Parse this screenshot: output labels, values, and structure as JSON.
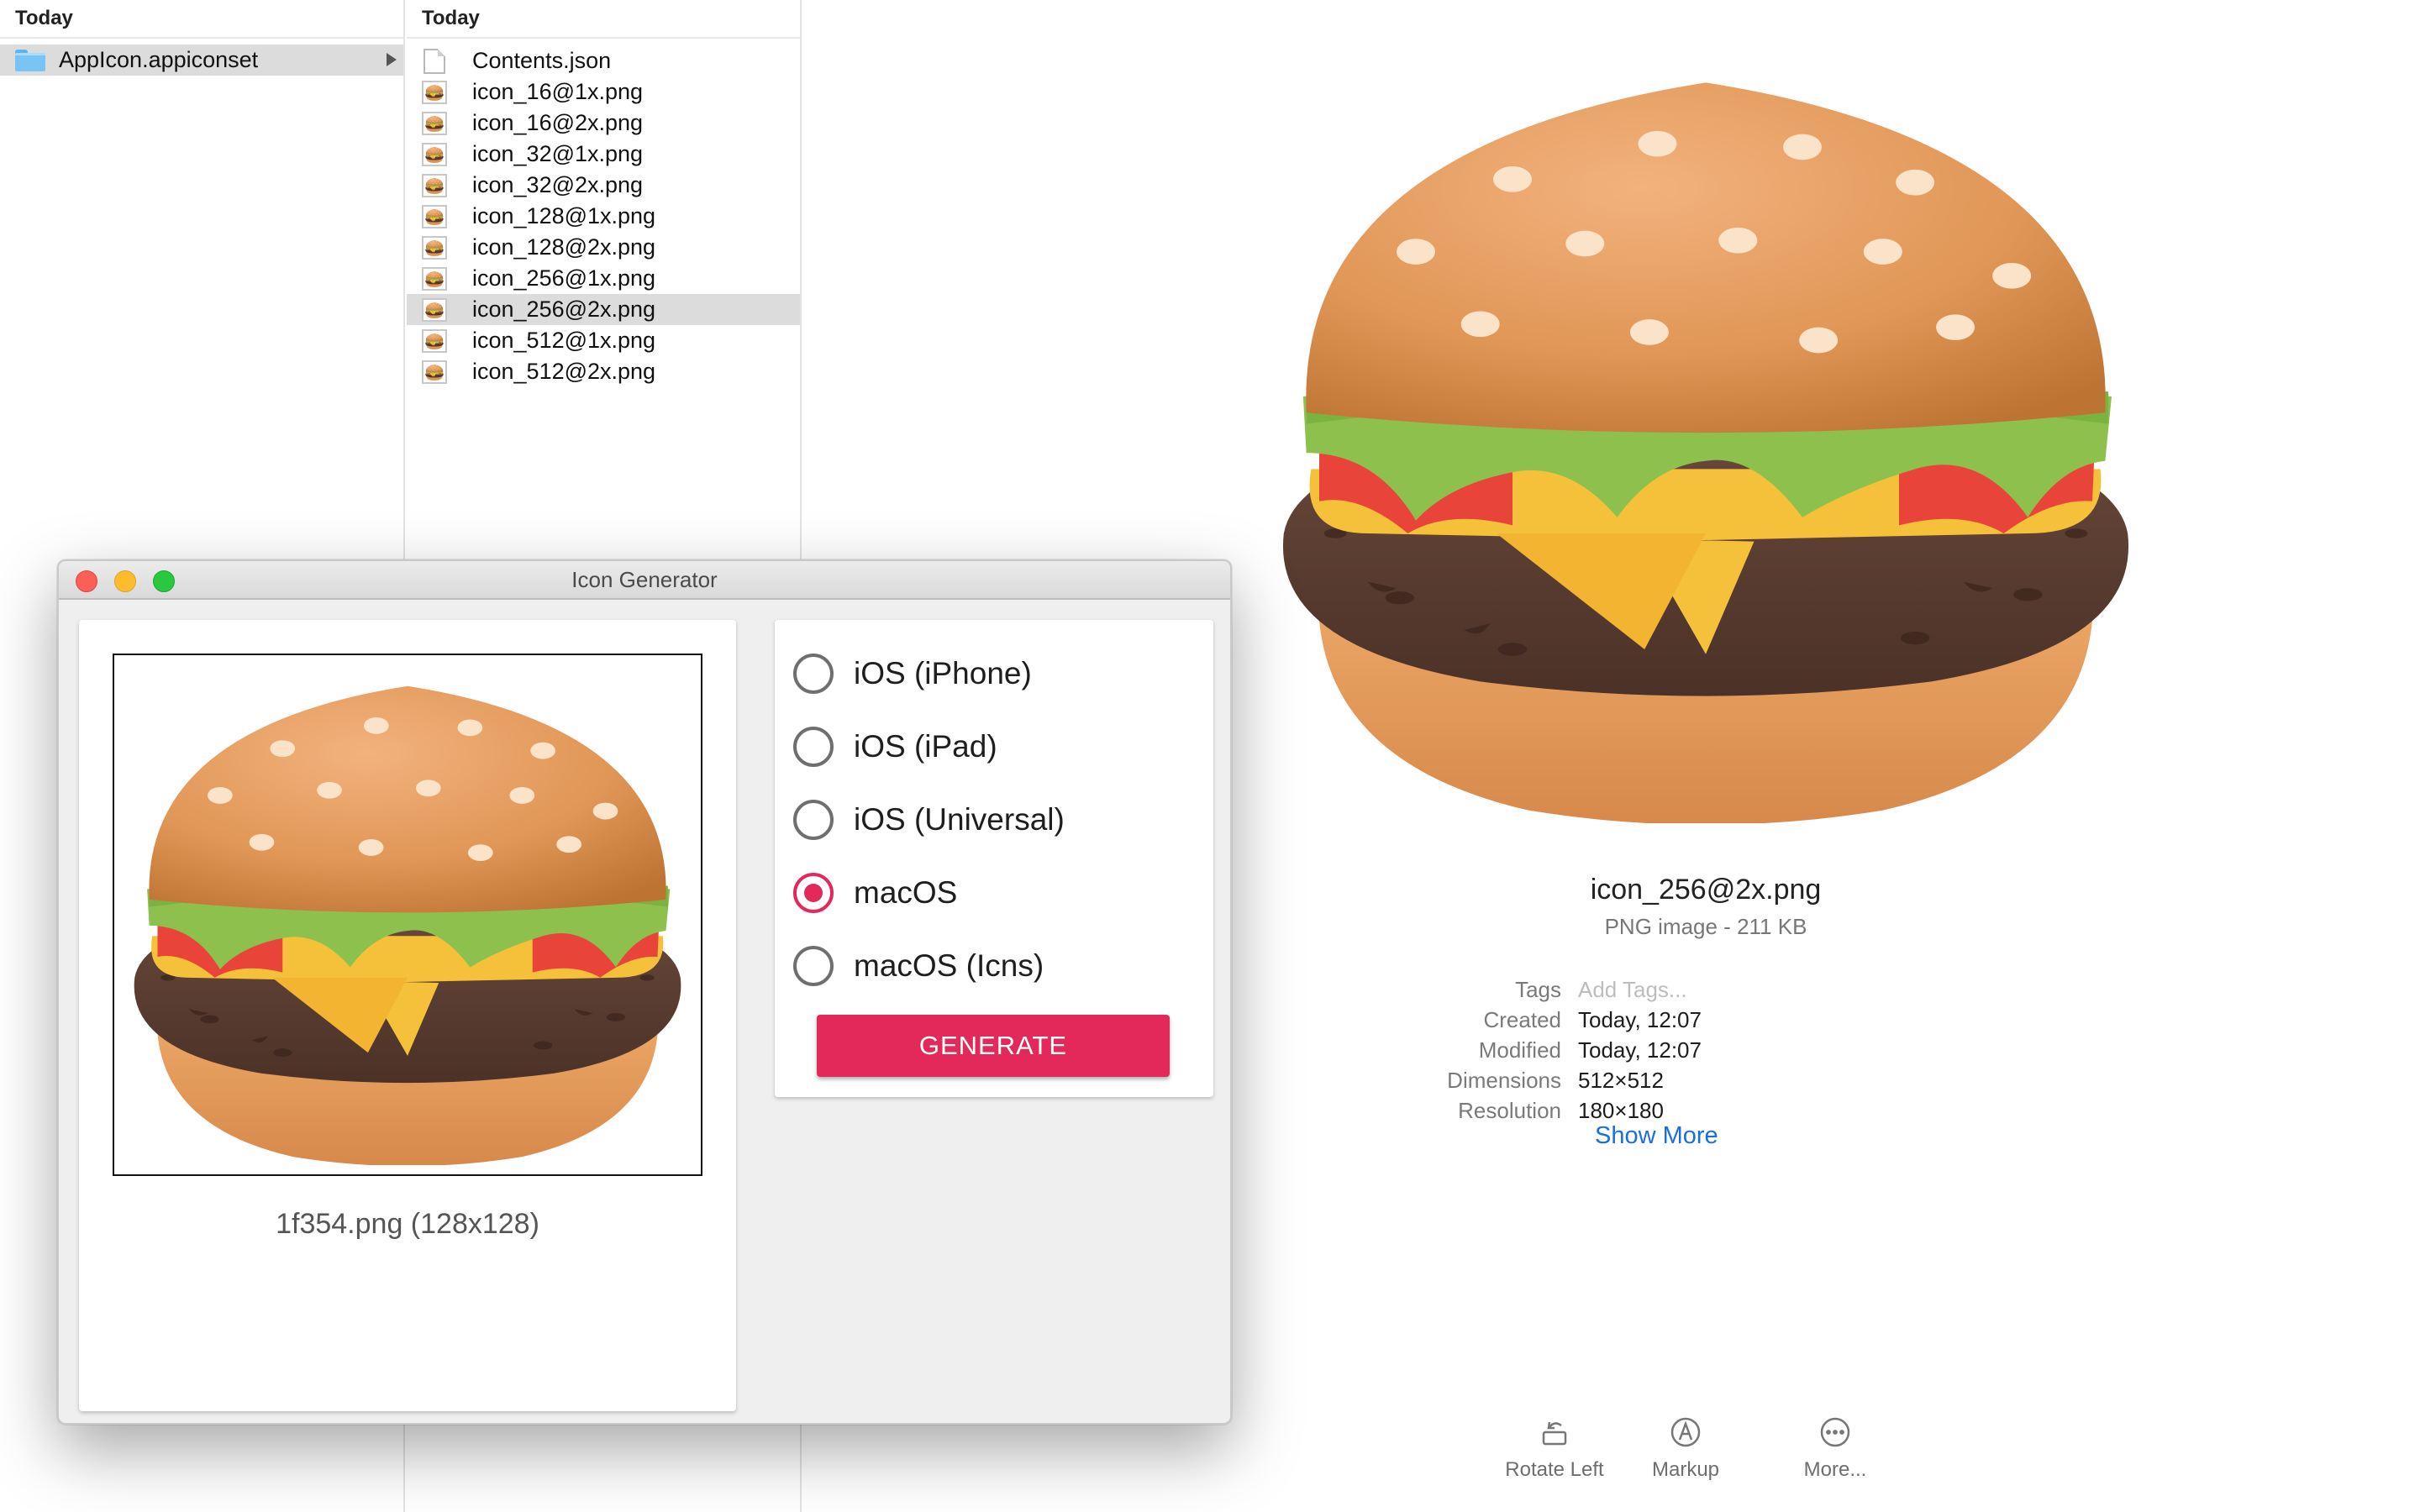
{
  "finder": {
    "column1": {
      "header": "Today",
      "items": [
        {
          "label": "AppIcon.appiconset",
          "type": "folder",
          "selected": true
        }
      ]
    },
    "column2": {
      "header": "Today",
      "items": [
        {
          "label": "Contents.json",
          "type": "document",
          "selected": false
        },
        {
          "label": "icon_16@1x.png",
          "type": "image",
          "selected": false
        },
        {
          "label": "icon_16@2x.png",
          "type": "image",
          "selected": false
        },
        {
          "label": "icon_32@1x.png",
          "type": "image",
          "selected": false
        },
        {
          "label": "icon_32@2x.png",
          "type": "image",
          "selected": false
        },
        {
          "label": "icon_128@1x.png",
          "type": "image",
          "selected": false
        },
        {
          "label": "icon_128@2x.png",
          "type": "image",
          "selected": false
        },
        {
          "label": "icon_256@1x.png",
          "type": "image",
          "selected": false
        },
        {
          "label": "icon_256@2x.png",
          "type": "image",
          "selected": true
        },
        {
          "label": "icon_512@1x.png",
          "type": "image",
          "selected": false
        },
        {
          "label": "icon_512@2x.png",
          "type": "image",
          "selected": false
        }
      ]
    }
  },
  "preview": {
    "filename": "icon_256@2x.png",
    "subtitle": "PNG image - 211 KB",
    "metadata": [
      {
        "key": "Tags",
        "value": "Add Tags...",
        "placeholder": true
      },
      {
        "key": "Created",
        "value": "Today, 12:07",
        "placeholder": false
      },
      {
        "key": "Modified",
        "value": "Today, 12:07",
        "placeholder": false
      },
      {
        "key": "Dimensions",
        "value": "512×512",
        "placeholder": false
      },
      {
        "key": "Resolution",
        "value": "180×180",
        "placeholder": false
      }
    ],
    "show_more": "Show More",
    "actions": {
      "rotate_left": "Rotate Left",
      "markup": "Markup",
      "more": "More..."
    }
  },
  "icon_generator": {
    "window_title": "Icon Generator",
    "image_caption": "1f354.png (128x128)",
    "options": [
      {
        "label": "iOS (iPhone)",
        "checked": false
      },
      {
        "label": "iOS (iPad)",
        "checked": false
      },
      {
        "label": "iOS (Universal)",
        "checked": false
      },
      {
        "label": "macOS",
        "checked": true
      },
      {
        "label": "macOS (Icns)",
        "checked": false
      }
    ],
    "generate_label": "GENERATE"
  },
  "colors": {
    "accent": "#e3285a",
    "link": "#1a6fe0",
    "selection": "#dcdcdc",
    "folder": "#79c3f5"
  },
  "icons": {
    "folder": "folder-icon",
    "document": "document-icon",
    "image_thumbnail": "hamburger-emoji-icon",
    "preview_image": "hamburger-emoji-icon",
    "rotate_left": "rotate-left-icon",
    "markup": "markup-pen-icon",
    "more": "ellipsis-circle-icon"
  }
}
